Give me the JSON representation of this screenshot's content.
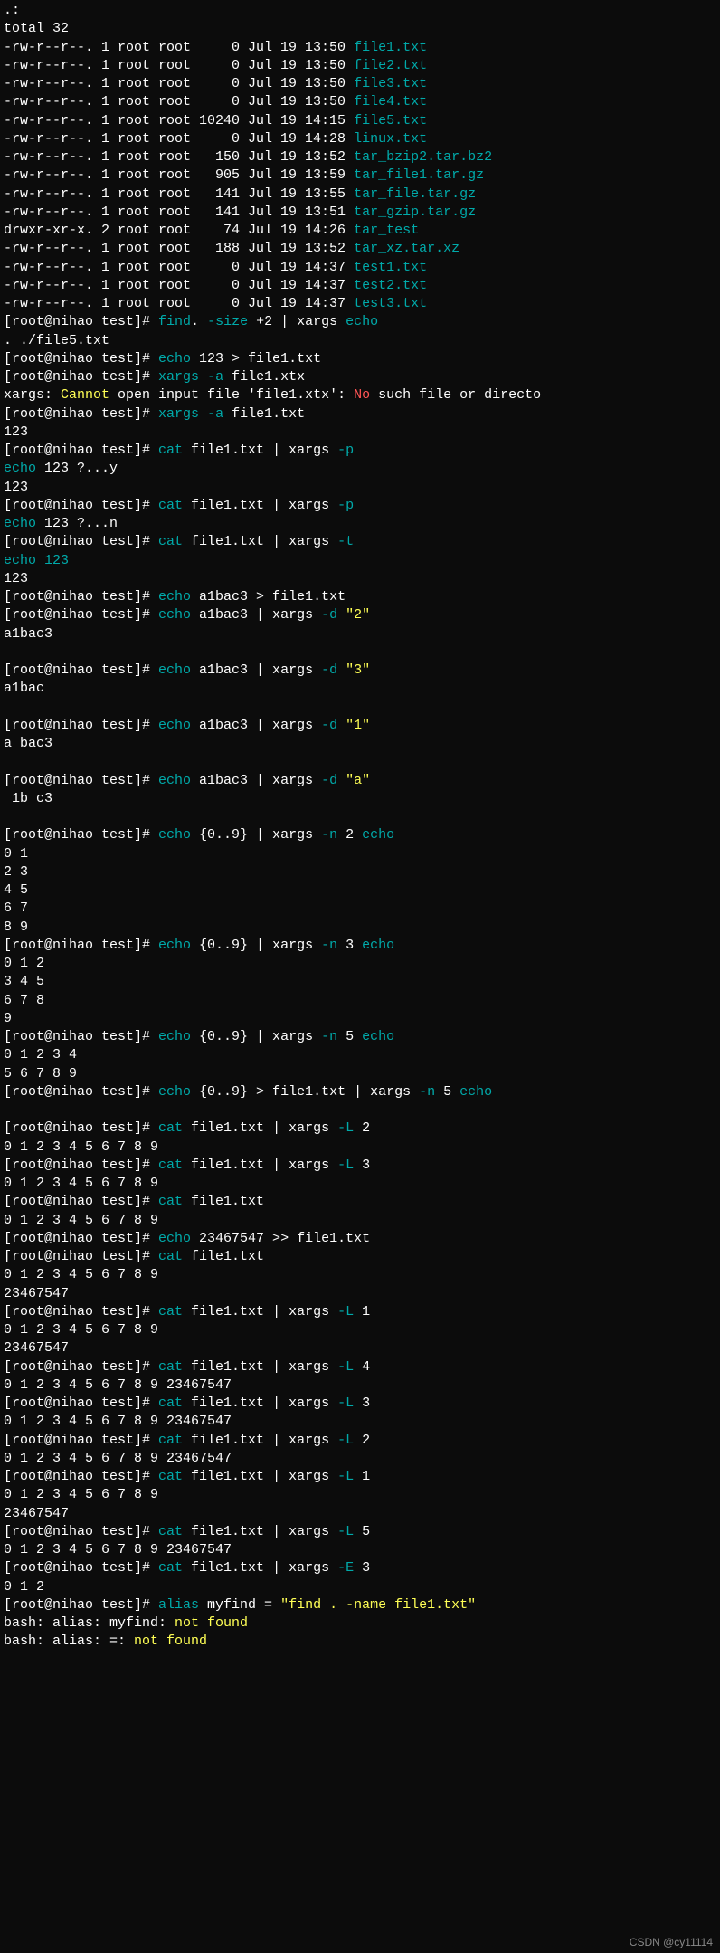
{
  "header": ".:",
  "total": "total 32",
  "files": [
    {
      "perm": "-rw-r--r--.",
      "links": "1",
      "owner": "root",
      "group": "root",
      "size": "    0",
      "month": "Jul",
      "day": "19",
      "time": "13:50",
      "name": "file1.txt"
    },
    {
      "perm": "-rw-r--r--.",
      "links": "1",
      "owner": "root",
      "group": "root",
      "size": "    0",
      "month": "Jul",
      "day": "19",
      "time": "13:50",
      "name": "file2.txt"
    },
    {
      "perm": "-rw-r--r--.",
      "links": "1",
      "owner": "root",
      "group": "root",
      "size": "    0",
      "month": "Jul",
      "day": "19",
      "time": "13:50",
      "name": "file3.txt"
    },
    {
      "perm": "-rw-r--r--.",
      "links": "1",
      "owner": "root",
      "group": "root",
      "size": "    0",
      "month": "Jul",
      "day": "19",
      "time": "13:50",
      "name": "file4.txt"
    },
    {
      "perm": "-rw-r--r--.",
      "links": "1",
      "owner": "root",
      "group": "root",
      "size": "10240",
      "month": "Jul",
      "day": "19",
      "time": "14:15",
      "name": "file5.txt"
    },
    {
      "perm": "-rw-r--r--.",
      "links": "1",
      "owner": "root",
      "group": "root",
      "size": "    0",
      "month": "Jul",
      "day": "19",
      "time": "14:28",
      "name": "linux.txt"
    },
    {
      "perm": "-rw-r--r--.",
      "links": "1",
      "owner": "root",
      "group": "root",
      "size": "  150",
      "month": "Jul",
      "day": "19",
      "time": "13:52",
      "name": "tar_bzip2.tar.bz2"
    },
    {
      "perm": "-rw-r--r--.",
      "links": "1",
      "owner": "root",
      "group": "root",
      "size": "  905",
      "month": "Jul",
      "day": "19",
      "time": "13:59",
      "name": "tar_file1.tar.gz"
    },
    {
      "perm": "-rw-r--r--.",
      "links": "1",
      "owner": "root",
      "group": "root",
      "size": "  141",
      "month": "Jul",
      "day": "19",
      "time": "13:55",
      "name": "tar_file.tar.gz"
    },
    {
      "perm": "-rw-r--r--.",
      "links": "1",
      "owner": "root",
      "group": "root",
      "size": "  141",
      "month": "Jul",
      "day": "19",
      "time": "13:51",
      "name": "tar_gzip.tar.gz"
    },
    {
      "perm": "drwxr-xr-x.",
      "links": "2",
      "owner": "root",
      "group": "root",
      "size": "   74",
      "month": "Jul",
      "day": "19",
      "time": "14:26",
      "name": "tar_test"
    },
    {
      "perm": "-rw-r--r--.",
      "links": "1",
      "owner": "root",
      "group": "root",
      "size": "  188",
      "month": "Jul",
      "day": "19",
      "time": "13:52",
      "name": "tar_xz.tar.xz"
    },
    {
      "perm": "-rw-r--r--.",
      "links": "1",
      "owner": "root",
      "group": "root",
      "size": "    0",
      "month": "Jul",
      "day": "19",
      "time": "14:37",
      "name": "test1.txt"
    },
    {
      "perm": "-rw-r--r--.",
      "links": "1",
      "owner": "root",
      "group": "root",
      "size": "    0",
      "month": "Jul",
      "day": "19",
      "time": "14:37",
      "name": "test2.txt"
    },
    {
      "perm": "-rw-r--r--.",
      "links": "1",
      "owner": "root",
      "group": "root",
      "size": "    0",
      "month": "Jul",
      "day": "19",
      "time": "14:37",
      "name": "test3.txt"
    }
  ],
  "prompt_user": "root",
  "prompt_host": "nihao",
  "prompt_dir": "test",
  "lines": [
    {
      "t": "prompt",
      "cmd": "find",
      "args": [
        ". "
      ],
      "opts": [
        "-size"
      ],
      "post": " +2 | xargs ",
      "end": "echo",
      "endcls": "arg"
    },
    {
      "t": "out",
      "text": ". ./file5.txt"
    },
    {
      "t": "prompt",
      "cmd": "echo",
      "args": [
        " 123 > file1.txt"
      ]
    },
    {
      "t": "prompt",
      "cmd": "xargs",
      "args": [
        " "
      ],
      "opts": [
        "-a"
      ],
      "post": " file1.xtx"
    },
    {
      "t": "err",
      "pre": "xargs: ",
      "h1": "Cannot",
      "m1": " open input file 'file1.xtx': ",
      "h2": "No",
      "m2": " such file or directo"
    },
    {
      "t": "prompt",
      "cmd": "xargs",
      "args": [
        " "
      ],
      "opts": [
        "-a"
      ],
      "post": " file1.txt"
    },
    {
      "t": "out",
      "text": "123"
    },
    {
      "t": "prompt",
      "cmd": "cat",
      "args": [
        " file1.txt | xargs "
      ],
      "opts": [
        "-p"
      ]
    },
    {
      "t": "echoq",
      "text": "echo 123 ?...y"
    },
    {
      "t": "out",
      "text": "123"
    },
    {
      "t": "prompt",
      "cmd": "cat",
      "args": [
        " file1.txt | xargs "
      ],
      "opts": [
        "-p"
      ]
    },
    {
      "t": "echoq",
      "text": "echo 123 ?...n"
    },
    {
      "t": "prompt",
      "cmd": "cat",
      "args": [
        " file1.txt | xargs "
      ],
      "opts": [
        "-t"
      ]
    },
    {
      "t": "echol",
      "text": "echo 123"
    },
    {
      "t": "out",
      "text": "123"
    },
    {
      "t": "prompt",
      "cmd": "echo",
      "args": [
        " a1bac3 > file1.txt"
      ]
    },
    {
      "t": "prompt",
      "cmd": "echo",
      "args": [
        " a1bac3 | xargs "
      ],
      "opts": [
        "-d"
      ],
      "post": " ",
      "str": "\"2\""
    },
    {
      "t": "out",
      "text": "a1bac3"
    },
    {
      "t": "blank"
    },
    {
      "t": "prompt",
      "cmd": "echo",
      "args": [
        " a1bac3 | xargs "
      ],
      "opts": [
        "-d"
      ],
      "post": " ",
      "str": "\"3\""
    },
    {
      "t": "out",
      "text": "a1bac"
    },
    {
      "t": "blank"
    },
    {
      "t": "prompt",
      "cmd": "echo",
      "args": [
        " a1bac3 | xargs "
      ],
      "opts": [
        "-d"
      ],
      "post": " ",
      "str": "\"1\""
    },
    {
      "t": "out",
      "text": "a bac3"
    },
    {
      "t": "blank"
    },
    {
      "t": "prompt",
      "cmd": "echo",
      "args": [
        " a1bac3 | xargs "
      ],
      "opts": [
        "-d"
      ],
      "post": " ",
      "str": "\"a\""
    },
    {
      "t": "out",
      "text": " 1b c3"
    },
    {
      "t": "blank"
    },
    {
      "t": "prompt",
      "cmd": "echo",
      "args": [
        " {0..9} | xargs "
      ],
      "opts": [
        "-n"
      ],
      "post": " 2 ",
      "end": "echo",
      "endcls": "arg"
    },
    {
      "t": "out",
      "text": "0 1"
    },
    {
      "t": "out",
      "text": "2 3"
    },
    {
      "t": "out",
      "text": "4 5"
    },
    {
      "t": "out",
      "text": "6 7"
    },
    {
      "t": "out",
      "text": "8 9"
    },
    {
      "t": "prompt",
      "cmd": "echo",
      "args": [
        " {0..9} | xargs "
      ],
      "opts": [
        "-n"
      ],
      "post": " 3 ",
      "end": "echo",
      "endcls": "arg"
    },
    {
      "t": "out",
      "text": "0 1 2"
    },
    {
      "t": "out",
      "text": "3 4 5"
    },
    {
      "t": "out",
      "text": "6 7 8"
    },
    {
      "t": "out",
      "text": "9"
    },
    {
      "t": "prompt",
      "cmd": "echo",
      "args": [
        " {0..9} | xargs "
      ],
      "opts": [
        "-n"
      ],
      "post": " 5 ",
      "end": "echo",
      "endcls": "arg"
    },
    {
      "t": "out",
      "text": "0 1 2 3 4"
    },
    {
      "t": "out",
      "text": "5 6 7 8 9"
    },
    {
      "t": "prompt",
      "cmd": "echo",
      "args": [
        " {0..9} > file1.txt | xargs "
      ],
      "opts": [
        "-n"
      ],
      "post": " 5 ",
      "end": "echo",
      "endcls": "arg"
    },
    {
      "t": "blank"
    },
    {
      "t": "prompt",
      "cmd": "cat",
      "args": [
        " file1.txt | xargs "
      ],
      "opts": [
        "-L"
      ],
      "post": " 2"
    },
    {
      "t": "out",
      "text": "0 1 2 3 4 5 6 7 8 9"
    },
    {
      "t": "prompt",
      "cmd": "cat",
      "args": [
        " file1.txt | xargs "
      ],
      "opts": [
        "-L"
      ],
      "post": " 3"
    },
    {
      "t": "out",
      "text": "0 1 2 3 4 5 6 7 8 9"
    },
    {
      "t": "prompt",
      "cmd": "cat",
      "args": [
        " file1.txt"
      ]
    },
    {
      "t": "out",
      "text": "0 1 2 3 4 5 6 7 8 9"
    },
    {
      "t": "prompt",
      "cmd": "echo",
      "args": [
        " 23467547 >> file1.txt"
      ]
    },
    {
      "t": "prompt",
      "cmd": "cat",
      "args": [
        " file1.txt"
      ]
    },
    {
      "t": "out",
      "text": "0 1 2 3 4 5 6 7 8 9"
    },
    {
      "t": "out",
      "text": "23467547"
    },
    {
      "t": "prompt",
      "cmd": "cat",
      "args": [
        " file1.txt | xargs "
      ],
      "opts": [
        "-L"
      ],
      "post": " 1"
    },
    {
      "t": "out",
      "text": "0 1 2 3 4 5 6 7 8 9"
    },
    {
      "t": "out",
      "text": "23467547"
    },
    {
      "t": "prompt",
      "cmd": "cat",
      "args": [
        " file1.txt | xargs "
      ],
      "opts": [
        "-L"
      ],
      "post": " 4"
    },
    {
      "t": "out",
      "text": "0 1 2 3 4 5 6 7 8 9 23467547"
    },
    {
      "t": "prompt",
      "cmd": "cat",
      "args": [
        " file1.txt | xargs "
      ],
      "opts": [
        "-L"
      ],
      "post": " 3"
    },
    {
      "t": "out",
      "text": "0 1 2 3 4 5 6 7 8 9 23467547"
    },
    {
      "t": "prompt",
      "cmd": "cat",
      "args": [
        " file1.txt | xargs "
      ],
      "opts": [
        "-L"
      ],
      "post": " 2"
    },
    {
      "t": "out",
      "text": "0 1 2 3 4 5 6 7 8 9 23467547"
    },
    {
      "t": "prompt",
      "cmd": "cat",
      "args": [
        " file1.txt | xargs "
      ],
      "opts": [
        "-L"
      ],
      "post": " 1"
    },
    {
      "t": "out",
      "text": "0 1 2 3 4 5 6 7 8 9"
    },
    {
      "t": "out",
      "text": "23467547"
    },
    {
      "t": "prompt",
      "cmd": "cat",
      "args": [
        " file1.txt | xargs "
      ],
      "opts": [
        "-L"
      ],
      "post": " 5"
    },
    {
      "t": "out",
      "text": "0 1 2 3 4 5 6 7 8 9 23467547"
    },
    {
      "t": "prompt",
      "cmd": "cat",
      "args": [
        " file1.txt | xargs "
      ],
      "opts": [
        "-E"
      ],
      "post": " 3"
    },
    {
      "t": "out",
      "text": "0 1 2"
    },
    {
      "t": "prompt",
      "cmd": "alias",
      "args": [
        " myfind = "
      ],
      "str": "\"find . -name file1.txt\""
    },
    {
      "t": "basherr",
      "text": "bash: alias: myfind: ",
      "nf": "not found"
    },
    {
      "t": "basherr",
      "text": "bash: alias: =: ",
      "nf": "not found"
    }
  ],
  "watermark": "CSDN @cy11114"
}
